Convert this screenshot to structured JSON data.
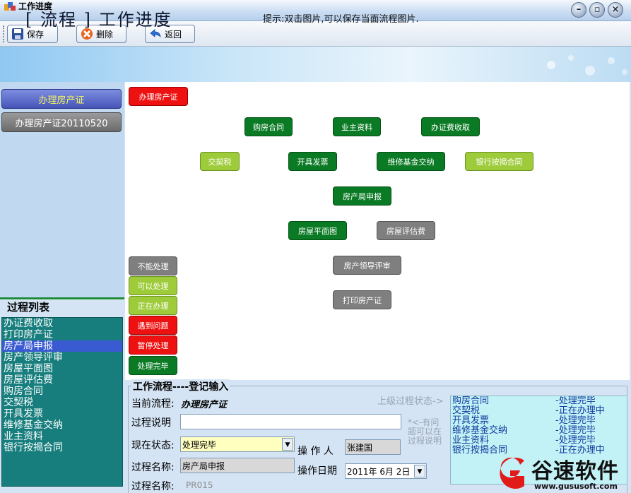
{
  "window": {
    "title": "工作进度"
  },
  "toolbar": {
    "save_label": "保存",
    "delete_label": "删除",
    "back_label": "返回"
  },
  "banner": {
    "title": "[ 流程 ] 工作进度",
    "hint": "提示:双击图片,可以保存当面流程图片."
  },
  "left": {
    "flows": [
      "办理房产证",
      "办理房产证20110520"
    ],
    "process_list_title": "过程列表",
    "process_list": [
      "办证费收取",
      "打印房产证",
      "房产局申报",
      "房产领导评审",
      "房屋平面图",
      "房屋评估费",
      "购房合同",
      "交契税",
      "开具发票",
      "维修基金交纳",
      "业主资料",
      "银行按揭合同"
    ],
    "selected_index": 2
  },
  "diagram": {
    "root": {
      "label": "办理房产证",
      "status": "red"
    },
    "nodes": [
      {
        "label": "购房合同",
        "status": "dg"
      },
      {
        "label": "业主资料",
        "status": "dg"
      },
      {
        "label": "办证费收取",
        "status": "dg"
      },
      {
        "label": "交契税",
        "status": "lg"
      },
      {
        "label": "开具发票",
        "status": "dg"
      },
      {
        "label": "维修基金交纳",
        "status": "dg"
      },
      {
        "label": "银行按揭合同",
        "status": "lg"
      },
      {
        "label": "房产局申报",
        "status": "dg"
      },
      {
        "label": "房屋平面图",
        "status": "dg"
      },
      {
        "label": "房屋评估费",
        "status": "gray"
      },
      {
        "label": "房产领导评审",
        "status": "gray"
      },
      {
        "label": "打印房产证",
        "status": "gray"
      }
    ],
    "legend": [
      {
        "label": "不能处理",
        "status": "gray"
      },
      {
        "label": "可以处理",
        "status": "lg"
      },
      {
        "label": "正在办理",
        "status": "lg"
      },
      {
        "label": "遇到问题",
        "status": "red"
      },
      {
        "label": "暂停处理",
        "status": "red"
      },
      {
        "label": "处理完毕",
        "status": "dg"
      }
    ],
    "colors": {
      "red": "#ee1111",
      "dark_green": "#0a7a24",
      "light_green": "#9ecb3a",
      "gray": "#7f7f7f"
    }
  },
  "form": {
    "title": "工作流程----登记输入",
    "current_flow_label": "当前流程:",
    "current_flow_value": "办理房产证",
    "desc_label": "过程说明",
    "desc_value": "",
    "star_note": "*<-有问题可以在过程说明",
    "status_label": "现在状态:",
    "status_value": "处理完毕",
    "operator_label": "操 作 人",
    "operator_value": "张建国",
    "proc_name_label": "过程名称:",
    "proc_name_value": "房产局申报",
    "op_date_label": "操作日期",
    "op_date_value": "2011年 6月 2日",
    "proc_code_label": "过程名称:",
    "proc_code_value": "PR015",
    "prev_status_label": "上级过程状态->",
    "prev_status": [
      {
        "name": "购房合同",
        "state": "-处理完毕"
      },
      {
        "name": "交契税",
        "state": "-正在办理中"
      },
      {
        "name": "开具发票",
        "state": "-处理完毕"
      },
      {
        "name": "维修基金交纳",
        "state": "-处理完毕"
      },
      {
        "name": "业主资料",
        "state": "-处理完毕"
      },
      {
        "name": "银行按揭合同",
        "state": "-正在办理中"
      }
    ]
  },
  "watermark": {
    "brand": "谷速软件",
    "url": "www.gususoft.com"
  }
}
